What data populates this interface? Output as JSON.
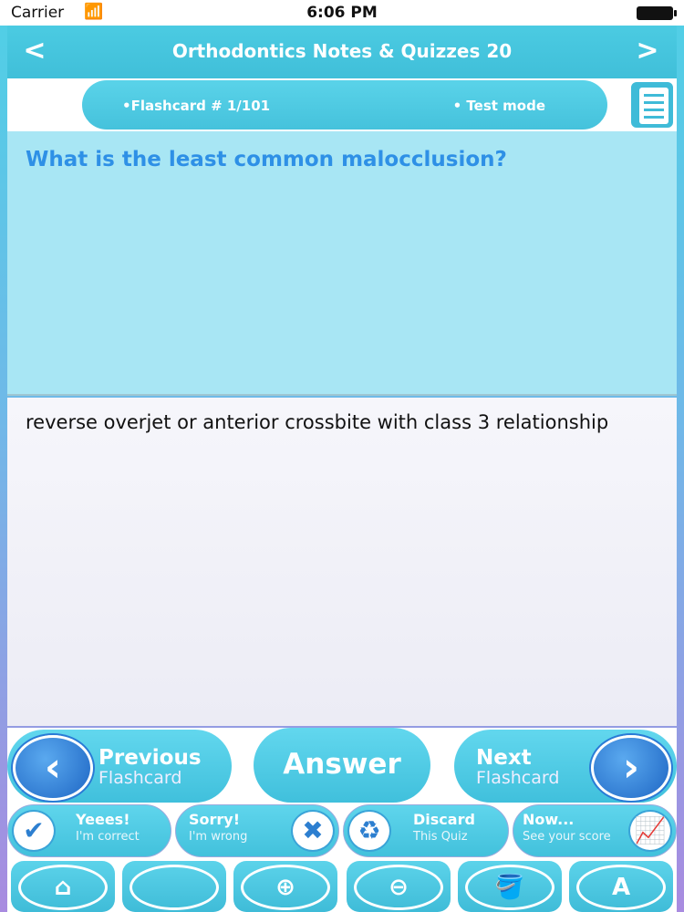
{
  "status": {
    "carrier": "Carrier",
    "time": "6:06 PM"
  },
  "navbar": {
    "prev_arrow": "<",
    "title": "Orthodontics Notes & Quizzes 20",
    "next_arrow": ">"
  },
  "info": {
    "flashcard_label": "•Flashcard #  1/101",
    "mode_label": "• Test mode"
  },
  "question": "What is the least common malocclusion?",
  "answer": "reverse overjet or anterior crossbite with class 3 relationship",
  "buttons": {
    "previous": {
      "line1": "Previous",
      "line2": "Flashcard"
    },
    "answer": "Answer",
    "next": {
      "line1": "Next",
      "line2": "Flashcard"
    }
  },
  "actions": {
    "correct": {
      "line1": "Yeees!",
      "line2": "I'm correct"
    },
    "wrong": {
      "line1": "Sorry!",
      "line2": "I'm wrong"
    },
    "discard": {
      "line1": "Discard",
      "line2": "This Quiz"
    },
    "score": {
      "line1": "Now...",
      "line2": "See your score"
    }
  },
  "toolbar": [
    "home-icon",
    "blank-icon",
    "zoom-in-icon",
    "zoom-out-icon",
    "paint-bucket-icon",
    "font-icon"
  ],
  "colors": {
    "accent": "#45c2dc",
    "question_text": "#2e90e6"
  }
}
